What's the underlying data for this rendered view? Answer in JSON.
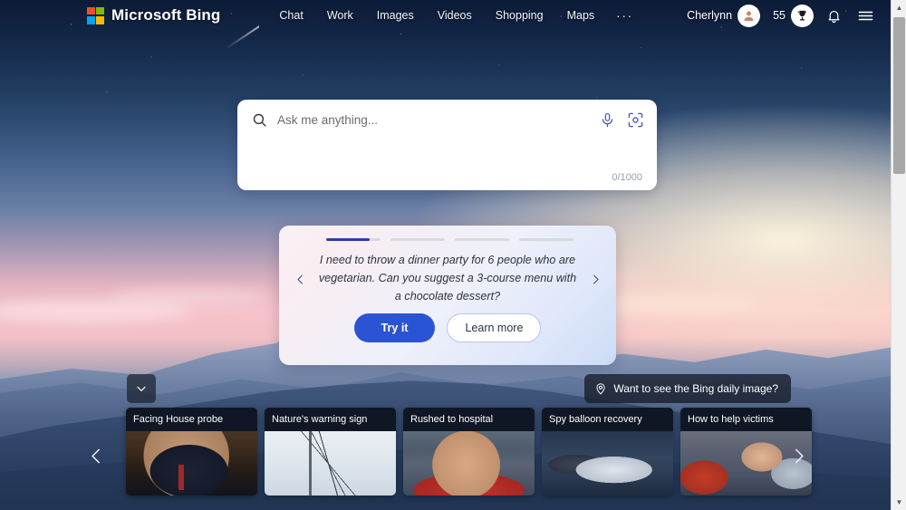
{
  "header": {
    "brand": "Microsoft Bing",
    "logo_colors": [
      "#f25022",
      "#7fba00",
      "#00a4ef",
      "#ffb900"
    ],
    "nav": [
      {
        "label": "Chat",
        "name": "nav-chat"
      },
      {
        "label": "Work",
        "name": "nav-work"
      },
      {
        "label": "Images",
        "name": "nav-images"
      },
      {
        "label": "Videos",
        "name": "nav-videos"
      },
      {
        "label": "Shopping",
        "name": "nav-shopping"
      },
      {
        "label": "Maps",
        "name": "nav-maps"
      },
      {
        "label": "···",
        "name": "nav-more"
      }
    ],
    "user_name": "Cherlynn",
    "rewards_count": "55",
    "avatar_icon": "person-icon",
    "rewards_icon": "trophy-icon",
    "notifications_icon": "bell-icon",
    "menu_icon": "hamburger-menu-icon"
  },
  "search": {
    "placeholder": "Ask me anything...",
    "value": "",
    "counter": "0/1000",
    "search_icon": "search-icon",
    "mic_icon": "microphone-icon",
    "camera_icon": "visual-search-camera-icon"
  },
  "suggestion": {
    "progress": [
      80,
      0,
      0,
      0
    ],
    "accent_color": "#2b3fa8",
    "text": "I need to throw a dinner party for 6 people who are vegetarian. Can you suggest a 3-course menu with a chocolate dessert?",
    "try_label": "Try it",
    "try_color": "#2b54d4",
    "learn_label": "Learn more",
    "prev_icon": "chevron-left-icon",
    "next_icon": "chevron-right-icon"
  },
  "daily_image": {
    "label": "Want to see the Bing daily image?",
    "icon": "location-pin-icon"
  },
  "collapse": {
    "icon": "chevron-down-icon"
  },
  "news": {
    "prev_icon": "chevron-left-icon",
    "next_icon": "chevron-right-icon",
    "cards": [
      {
        "title": "Facing House probe",
        "art": "art-hearing"
      },
      {
        "title": "Nature's warning sign",
        "art": "art-birds"
      },
      {
        "title": "Rushed to hospital",
        "art": "art-crowd-red"
      },
      {
        "title": "Spy balloon recovery",
        "art": "art-salvage"
      },
      {
        "title": "How to help victims",
        "art": "art-relief"
      }
    ]
  },
  "scrollbar": {
    "up_icon": "triangle-up-icon",
    "down_icon": "triangle-down-icon"
  }
}
